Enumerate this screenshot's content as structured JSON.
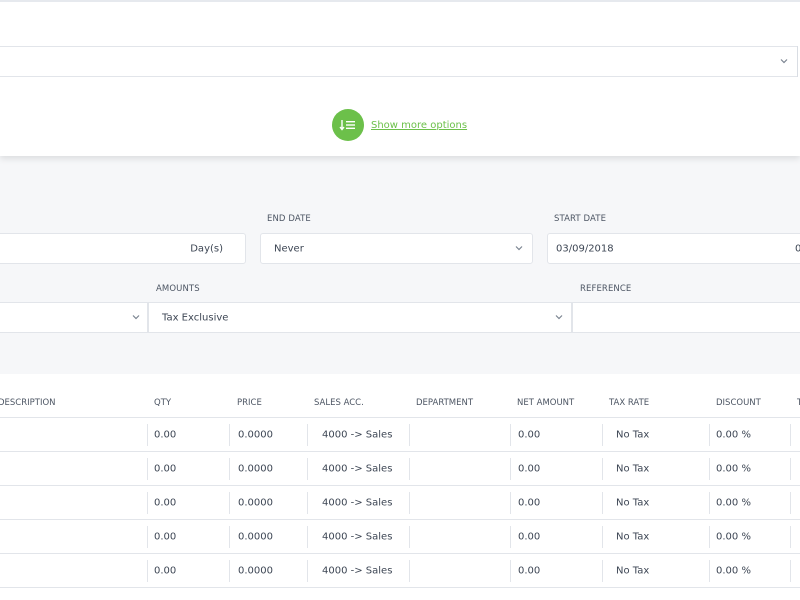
{
  "top": {
    "show_more_label": "Show more options"
  },
  "schedule": {
    "frequency_unit": "Day(s)",
    "end_date_label": "END DATE",
    "end_date_value": "Never",
    "start_date_label": "START DATE",
    "start_date_value": "03/09/2018",
    "start_date_overflow": "0"
  },
  "amounts": {
    "label": "AMOUNTS",
    "value": "Tax Exclusive"
  },
  "reference": {
    "label": "REFERENCE",
    "value": ""
  },
  "table": {
    "headers": {
      "description": "DESCRIPTION",
      "qty": "QTY",
      "price": "PRICE",
      "sales_acc": "SALES ACC.",
      "department": "DEPARTMENT",
      "net_amount": "NET AMOUNT",
      "tax_rate": "TAX RATE",
      "discount": "DISCOUNT",
      "overflow": "T"
    },
    "rows": [
      {
        "qty": "0.00",
        "price": "0.0000",
        "sales_acc": "4000 -> Sales",
        "net_amount": "0.00",
        "tax_rate": "No Tax",
        "discount": "0.00 %"
      },
      {
        "qty": "0.00",
        "price": "0.0000",
        "sales_acc": "4000 -> Sales",
        "net_amount": "0.00",
        "tax_rate": "No Tax",
        "discount": "0.00 %"
      },
      {
        "qty": "0.00",
        "price": "0.0000",
        "sales_acc": "4000 -> Sales",
        "net_amount": "0.00",
        "tax_rate": "No Tax",
        "discount": "0.00 %"
      },
      {
        "qty": "0.00",
        "price": "0.0000",
        "sales_acc": "4000 -> Sales",
        "net_amount": "0.00",
        "tax_rate": "No Tax",
        "discount": "0.00 %"
      },
      {
        "qty": "0.00",
        "price": "0.0000",
        "sales_acc": "4000 -> Sales",
        "net_amount": "0.00",
        "tax_rate": "No Tax",
        "discount": "0.00 %"
      }
    ]
  },
  "icons": {
    "show_more": "sort-list-icon",
    "dropdown": "chevron-down-icon"
  },
  "colors": {
    "accent": "#6cc04a",
    "background": "#f6f7f9"
  }
}
